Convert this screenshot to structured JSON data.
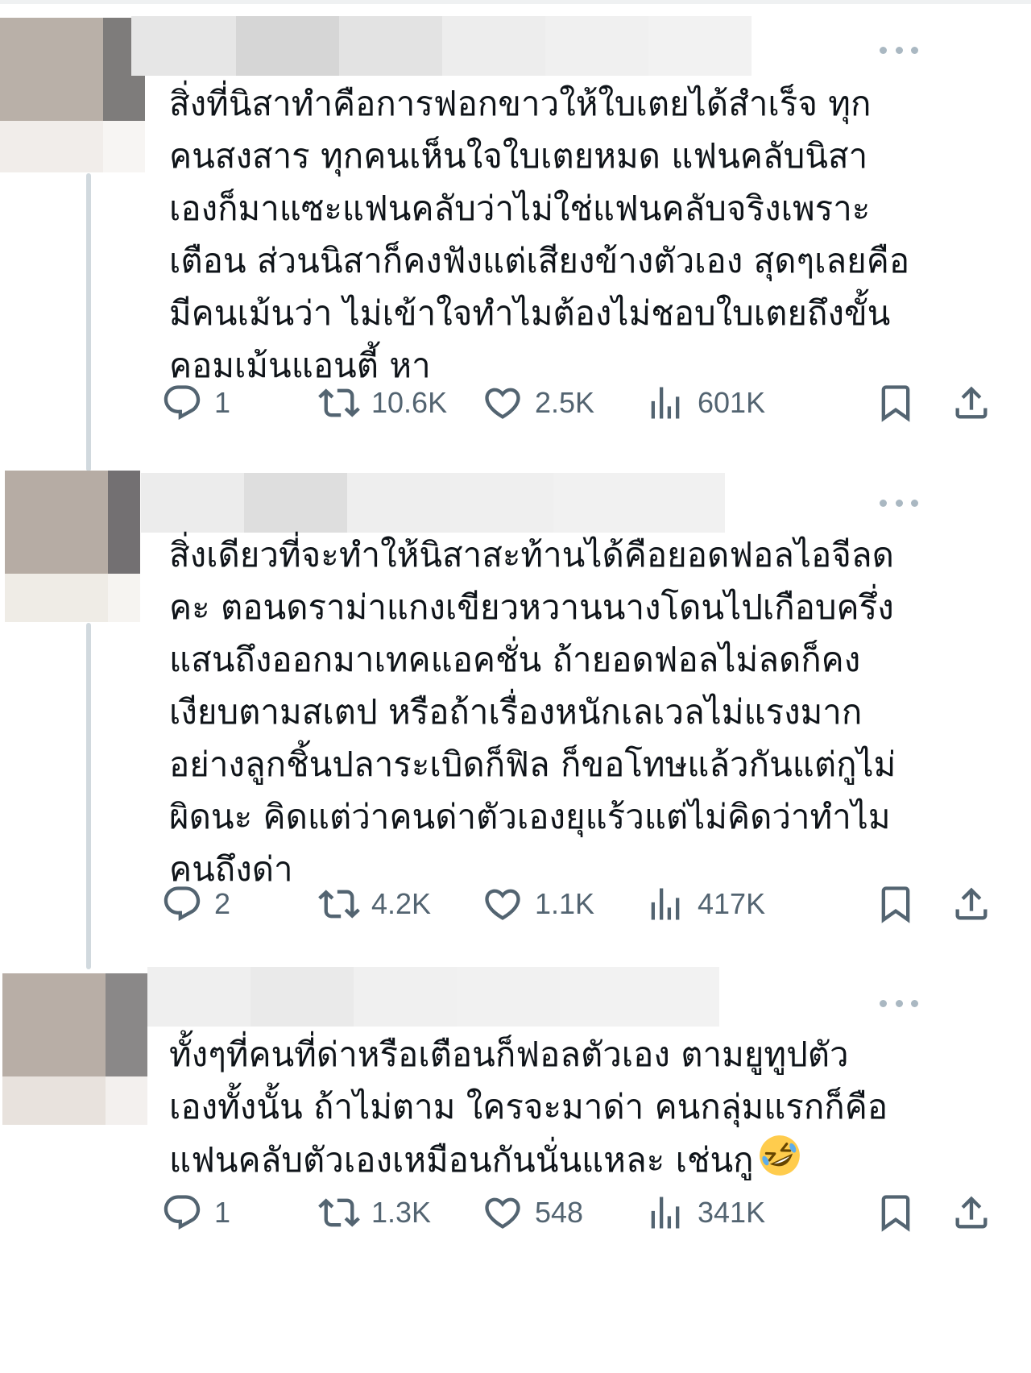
{
  "posts": [
    {
      "text_lines": [
        "สิ่งที่นิสาทำคือการฟอกขาวให้ใบเตยได้สำเร็จ ทุก",
        "คนสงสาร ทุกคนเห็นใจใบเตยหมด แฟนคลับนิสา",
        "เองก็มาแซะแฟนคลับว่าไม่ใช่แฟนคลับจริงเพราะ",
        "เตือน ส่วนนิสาก็คงฟังแต่เสียงข้างตัวเอง สุดๆเลยคือ",
        "มีคนเม้นว่า ไม่เข้าใจทำไมต้องไม่ชอบใบเตยถึงขั้น",
        "คอมเม้นแอนตี้ หา"
      ],
      "replies": "1",
      "reposts": "10.6K",
      "likes": "2.5K",
      "views": "601K"
    },
    {
      "text_lines": [
        "สิ่งเดียวที่จะทำให้นิสาสะท้านได้คือยอดฟอลไอจีลด",
        "คะ ตอนดราม่าแกงเขียวหวานนางโดนไปเกือบครึ่ง",
        "แสนถึงออกมาเทคแอคชั่น ถ้ายอดฟอลไม่ลดก็คง",
        "เงียบตามสเตป หรือถ้าเรื่องหนักเลเวลไม่แรงมาก",
        "อย่างลูกชิ้นปลาระเบิดก็ฟิล ก็ขอโทษแล้วกันแต่กูไม่",
        "ผิดนะ คิดแต่ว่าคนด่าตัวเองยุแร้วแต่ไม่คิดว่าทำไม",
        "คนถึงด่า"
      ],
      "replies": "2",
      "reposts": "4.2K",
      "likes": "1.1K",
      "views": "417K"
    },
    {
      "text_lines": [
        "ทั้งๆที่คนที่ด่าหรือเตือนก็ฟอลตัวเอง ตามยูทูปตัว",
        "เองทั้งนั้น ถ้าไม่ตาม ใครจะมาด่า คนกลุ่มแรกก็คือ",
        "แฟนคลับตัวเองเหมือนกันนั่นแหละ เช่นกู"
      ],
      "emoji": "rolling-on-floor-laughing-emoji",
      "replies": "1",
      "reposts": "1.3K",
      "likes": "548",
      "views": "341K"
    }
  ],
  "icons": {
    "reply": "reply-icon",
    "repost": "repost-icon",
    "like": "heart-icon",
    "views": "views-chart-icon",
    "bookmark": "bookmark-icon",
    "share": "share-icon",
    "more": "more-dots-icon"
  },
  "colors": {
    "text": "#0f1419",
    "secondary": "#536471",
    "thread_line": "#d1d9de",
    "more_dots": "#aab8c2"
  }
}
